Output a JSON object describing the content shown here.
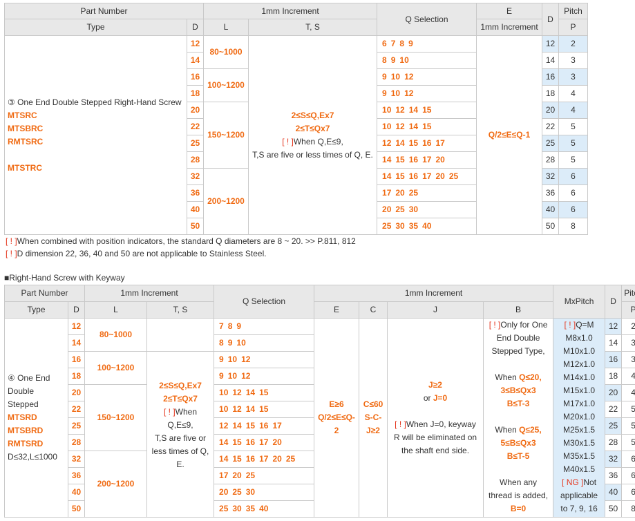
{
  "t1": {
    "h": {
      "part_number": "Part Number",
      "increment": "1mm Increment",
      "q_selection": "Q Selection",
      "e": "E",
      "e_increment": "1mm Increment",
      "d": "D",
      "pitch": "Pitch",
      "type": "Type",
      "d2": "D",
      "l": "L",
      "ts": "T, S",
      "p": "P"
    },
    "type_desc": "③ One End Double Stepped Right-Hand Screw",
    "models": [
      "MTSRC",
      "MTSBRC",
      "RMTSRC",
      "MTSTRC"
    ],
    "d_values": [
      "12",
      "14",
      "16",
      "18",
      "20",
      "22",
      "25",
      "28",
      "32",
      "36",
      "40",
      "50"
    ],
    "l_ranges": [
      "80~1000",
      "100~1200",
      "150~1200",
      "200~1200"
    ],
    "ts_line1": "2≤S≤Q,Ex7",
    "ts_line2": "2≤T≤Qx7",
    "ts_note_mark": "[ ! ]",
    "ts_note": "When Q,E≤9,",
    "ts_note2": "T,S are five or less times of Q, E.",
    "q_rows": [
      [
        "6",
        "7",
        "8",
        "9"
      ],
      [
        "8",
        "9",
        "10"
      ],
      [
        "9",
        "10",
        "12"
      ],
      [
        "9",
        "10",
        "12"
      ],
      [
        "10",
        "12",
        "14",
        "15"
      ],
      [
        "10",
        "12",
        "14",
        "15"
      ],
      [
        "12",
        "14",
        "15",
        "16",
        "17"
      ],
      [
        "14",
        "15",
        "16",
        "17",
        "20"
      ],
      [
        "14",
        "15",
        "16",
        "17",
        "20",
        "25"
      ],
      [
        "17",
        "20",
        "25"
      ],
      [
        "20",
        "25",
        "30"
      ],
      [
        "25",
        "30",
        "35",
        "40"
      ]
    ],
    "e_text": "Q/2≤E≤Q-1",
    "dp": [
      [
        "12",
        "2"
      ],
      [
        "14",
        "3"
      ],
      [
        "16",
        "3"
      ],
      [
        "18",
        "4"
      ],
      [
        "20",
        "4"
      ],
      [
        "22",
        "5"
      ],
      [
        "25",
        "5"
      ],
      [
        "28",
        "5"
      ],
      [
        "32",
        "6"
      ],
      [
        "36",
        "6"
      ],
      [
        "40",
        "6"
      ],
      [
        "50",
        "8"
      ]
    ]
  },
  "notes": {
    "n1_mark": "[ ! ]",
    "n1": "When combined with position indicators, the standard Q diameters are 8 ~ 20. >> P.811, 812",
    "n2_mark": "[ ! ]",
    "n2": "D dimension 22, 36, 40 and 50 are not applicable to Stainless Steel.",
    "section2": "■Right-Hand Screw with Keyway"
  },
  "t2": {
    "h": {
      "part_number": "Part Number",
      "increment": "1mm Increment",
      "q_selection": "Q Selection",
      "increment2": "1mm Increment",
      "mxpitch": "MxPitch",
      "d": "D",
      "pitch": "Pitch",
      "type": "Type",
      "d2": "D",
      "l": "L",
      "ts": "T, S",
      "e": "E",
      "c": "C",
      "j": "J",
      "b": "B",
      "p": "P"
    },
    "type_lines": [
      "④ One End",
      "Double",
      "Stepped"
    ],
    "models": [
      "MTSRD",
      "MTSBRD",
      "RMTSRD"
    ],
    "limit": "D≤32,L≤1000",
    "d_values": [
      "12",
      "14",
      "16",
      "18",
      "20",
      "22",
      "25",
      "28",
      "32",
      "36",
      "40",
      "50"
    ],
    "l_ranges": [
      "80~1000",
      "100~1200",
      "150~1200",
      "200~1200"
    ],
    "ts_line1": "2≤S≤Q,Ex7",
    "ts_line2": "2≤T≤Qx7",
    "ts_note_mark": "[ ! ]",
    "ts_note": "When",
    "ts_note2": "Q,E≤9,",
    "ts_note3": "T,S are five or",
    "ts_note4": "less times of Q,",
    "ts_note5": "E.",
    "q_rows": [
      [
        "7",
        "8",
        "9"
      ],
      [
        "8",
        "9",
        "10"
      ],
      [
        "9",
        "10",
        "12"
      ],
      [
        "9",
        "10",
        "12"
      ],
      [
        "10",
        "12",
        "14",
        "15"
      ],
      [
        "10",
        "12",
        "14",
        "15"
      ],
      [
        "12",
        "14",
        "15",
        "16",
        "17"
      ],
      [
        "14",
        "15",
        "16",
        "17",
        "20"
      ],
      [
        "14",
        "15",
        "16",
        "17",
        "20",
        "25"
      ],
      [
        "17",
        "20",
        "25"
      ],
      [
        "20",
        "25",
        "30"
      ],
      [
        "25",
        "30",
        "35",
        "40"
      ]
    ],
    "e_lines": [
      "E≥6",
      "Q/2≤E≤Q-",
      "2"
    ],
    "c_lines": [
      "C≤60",
      "S-C-",
      "J≥2"
    ],
    "j_line1": "J≥2",
    "j_or": "or",
    "j_line2": "J=0",
    "j_note_mark": "[ ! ]",
    "j_note1": "When J=0, keyway",
    "j_note2": "R will be eliminated on",
    "j_note3": "the shaft end side.",
    "b_mark": "[ ! ]",
    "b_note1": "Only for One",
    "b_note2": "End Double",
    "b_note3": "Stepped Type,",
    "b_when1": "When ",
    "b_cond1": "Q≤20,",
    "b_cond1b": "3≤B≤Qx3",
    "b_cond1c": "B≤T-3",
    "b_when2": "When ",
    "b_cond2": "Q≤25,",
    "b_cond2b": "5≤B≤Qx3",
    "b_cond2c": "B≤T-5",
    "b_any1": "When any",
    "b_any2": "thread is added,",
    "b_zero": "B=0",
    "mx_first_mark": "[ ! ]",
    "mx_first": "Q=M",
    "mx_values": [
      "M8x1.0",
      "M10x1.0",
      "M12x1.0",
      "M14x1.0",
      "M15x1.0",
      "M17x1.0",
      "M20x1.0",
      "M25x1.5",
      "M30x1.5",
      "M35x1.5",
      "M40x1.5"
    ],
    "mx_ng_mark": "[ NG ]",
    "mx_ng": "Not",
    "mx_ng2": "applicable",
    "mx_ng3": "to 7, 9, 16",
    "dp": [
      [
        "12",
        "2"
      ],
      [
        "14",
        "3"
      ],
      [
        "16",
        "3"
      ],
      [
        "18",
        "4"
      ],
      [
        "20",
        "4"
      ],
      [
        "22",
        "5"
      ],
      [
        "25",
        "5"
      ],
      [
        "28",
        "5"
      ],
      [
        "32",
        "6"
      ],
      [
        "36",
        "6"
      ],
      [
        "40",
        "6"
      ],
      [
        "50",
        "8"
      ]
    ]
  }
}
